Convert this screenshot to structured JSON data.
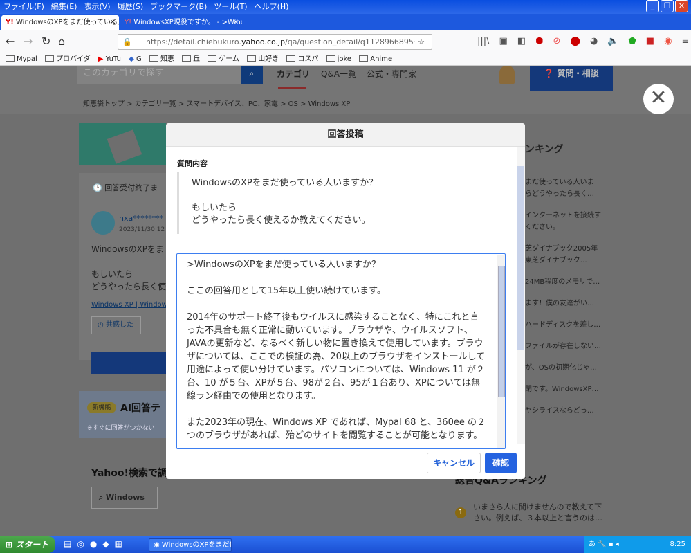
{
  "menubar": {
    "items": [
      "ファイル(F)",
      "編集(E)",
      "表示(V)",
      "履歴(S)",
      "ブックマーク(B)",
      "ツール(T)",
      "ヘルプ(H)"
    ]
  },
  "tabs": [
    {
      "label": "WindowsのXPをまだ使っている人い"
    },
    {
      "label": "WindowsXP現役ですか。 - >Wind"
    }
  ],
  "url": {
    "prefix": "https://detail.chiebukuro.",
    "domain": "yahoo.co.jp",
    "path": "/qa/question_detail/q1128966895"
  },
  "bookmarks": [
    "Mypal",
    "プロバイダ",
    "YuTu",
    "G",
    "知恵",
    "丘",
    "ゲーム",
    "山好き",
    "コスパ",
    "joke",
    "Anime"
  ],
  "page": {
    "search_placeholder": "このカテゴリで探す",
    "nav": [
      "カテゴリ",
      "Q&A一覧",
      "公式・専門家"
    ],
    "ask_button": "質問・相談",
    "breadcrumb": "知恵袋トップ  >  カテゴリ一覧  >  スマートデバイス、PC、家電  >  OS  >  Windows XP",
    "ranking_title": "ンキング",
    "status": "回答受付終了ま",
    "user": "hxa********",
    "date": "2023/11/30 12",
    "q_preview": "WindowsのXPをま",
    "q_preview2": "もしいたら",
    "q_preview3": "どうやったら長く使",
    "tags": "Windows XP | Windows",
    "empathy": "共感した",
    "new_badge": "新機能",
    "ai_title": "AI回答テ",
    "ai_note": "※すぐに回答がつかない",
    "yahoo_search": "Yahoo!検索で調",
    "windows_chip": "Windows",
    "total_ranking": "総合Q&Aランキング",
    "ranking_items": [
      "まだ使っている人いま",
      "らどうやったら長く…",
      "インターネットを接続す",
      "ください。",
      "芝ダイナブック2005年",
      "東芝ダイナブック…",
      "24MB程度のメモリで…",
      "ます！僕の友達がい…",
      "ハードディスクを差し…",
      "ファイルが存在しない…",
      "が、OSの初期化じゃ…",
      "閉です。WindowsXP…",
      "ヤシライスならどっ…"
    ],
    "bottom_rank": [
      "いまさら人に聞けませんので教えて下",
      "さい。例えば、３本以上と言うのは…"
    ],
    "rank_num": "1"
  },
  "modal": {
    "title": "回答投稿",
    "question_label": "質問内容",
    "question": [
      "WindowsのXPをまだ使っている人いますか？",
      "",
      "もしいたら",
      "どうやったら長く使えるか教えてください。"
    ],
    "answer": [
      ">WindowsのXPをまだ使っている人いますか？",
      "ここの回答用として15年以上使い続けています。",
      "2014年のサポート終了後もウイルスに感染することなく、特にこれと言った不具合も無く正常に動いています。ブラウザや、ウイルスソフト、JAVAの更新など、なるべく新しい物に置き換えて使用しています。ブラウザについては、ここでの検証の為、20以上のブラウザをインストールして用途によって使い分けています。パソコンについては、Windows 11 が２台、10 が５台、XPが５台、98が２台、95が１台あり、XPについては無線ラン経由での使用となります。",
      "また2023年の現在、Windows XP であれば、Mypal 68 と、360ee の２つのブラウザがあれば、殆どのサイトを閲覧することが可能となります。"
    ],
    "cancel": "キャンセル",
    "confirm": "確認"
  },
  "taskbar": {
    "start": "スタート",
    "item": "WindowsのXPをまだ使…",
    "clock": "8:25",
    "ime": "あ"
  },
  "colors": {
    "accent": "#2563e0",
    "titlebar": "#0a4ee0"
  }
}
